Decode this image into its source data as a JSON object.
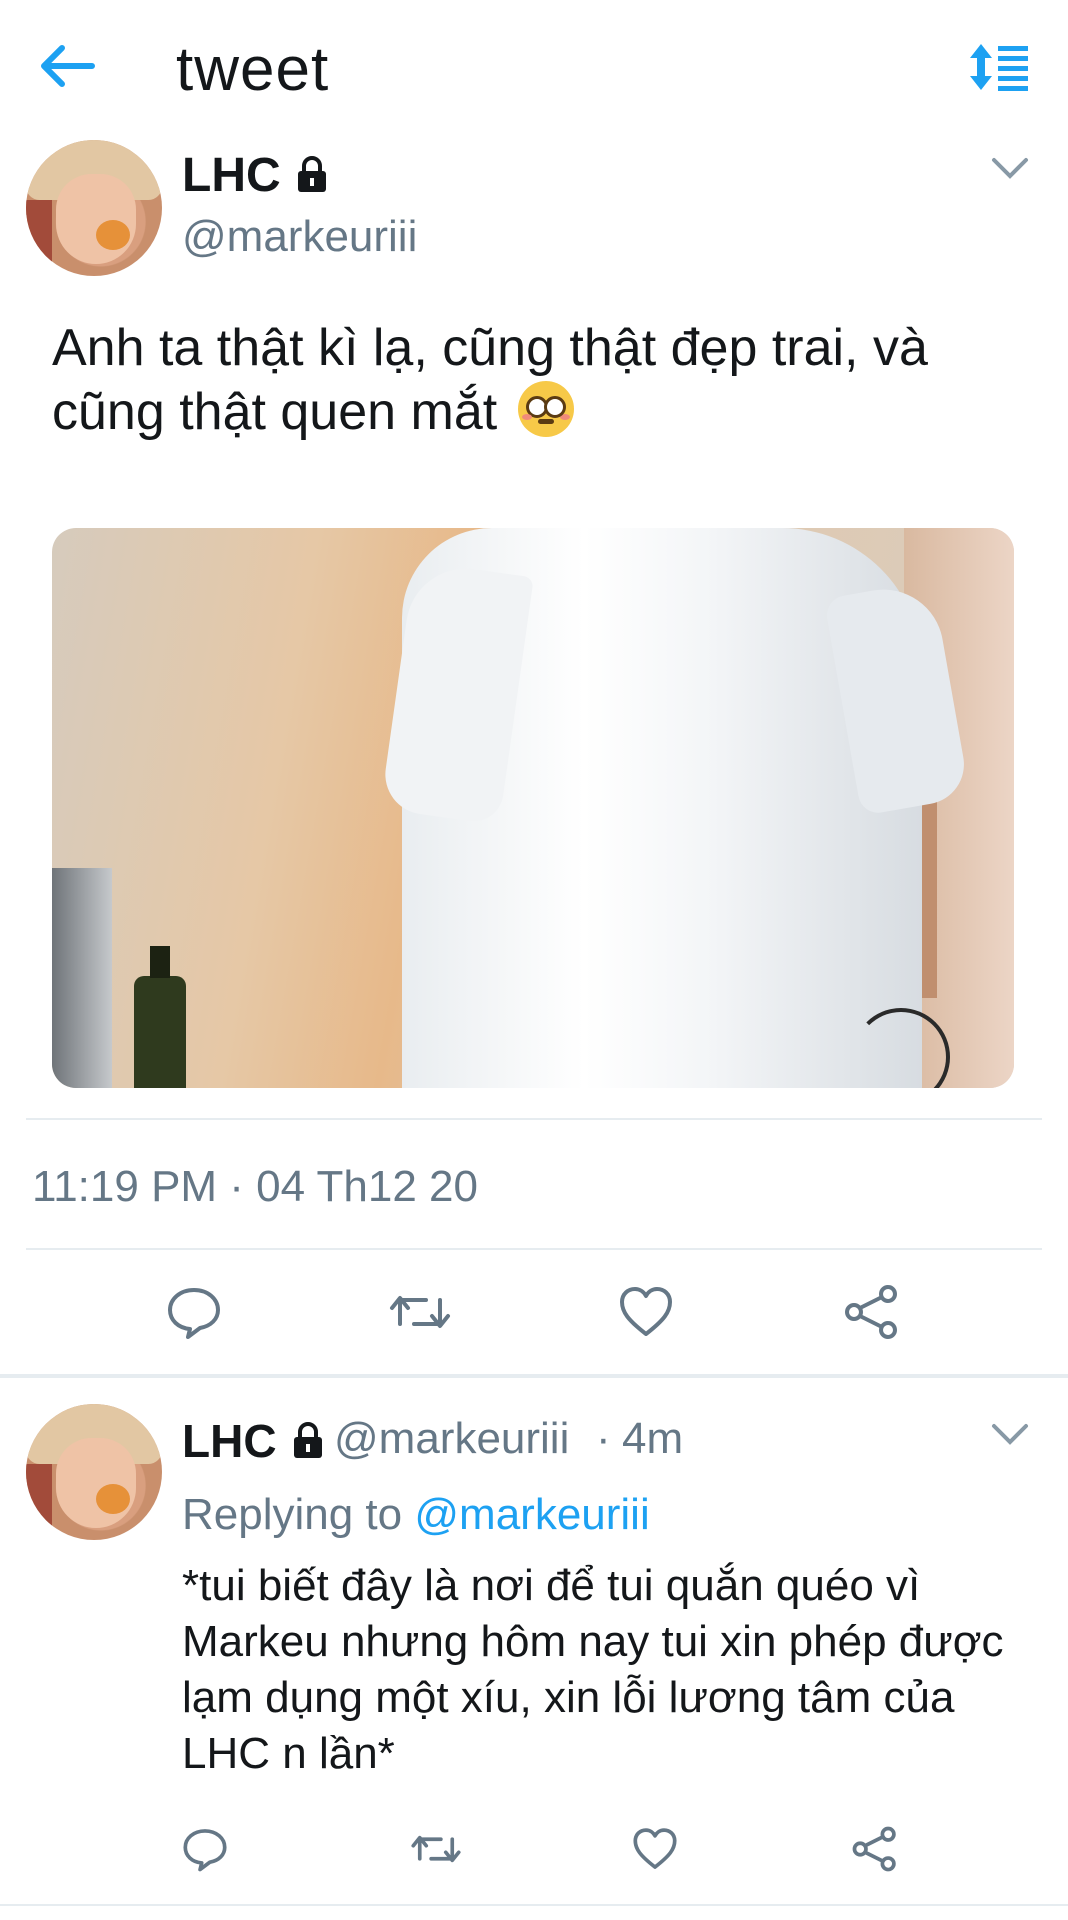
{
  "header": {
    "title": "tweet",
    "back_icon": "arrow-left-icon",
    "sort_icon": "sort-list-icon",
    "accent_color": "#1da1f2"
  },
  "tweet": {
    "author_name": "LHC",
    "author_handle": "@markeuriii",
    "protected_icon": "lock-icon",
    "text": "Anh ta thật kì lạ, cũng thật đẹp trai, và cũng thật quen mắt",
    "emoji": "flushed-face-emoji",
    "timestamp": "11:19 PM · 04 Th12 20",
    "actions": [
      "reply-icon",
      "retweet-icon",
      "like-icon",
      "share-icon"
    ]
  },
  "reply": {
    "author_name": "LHC",
    "author_handle": "@markeuriii",
    "separator": "·",
    "time_ago": "4m",
    "replying_prefix": "Replying to",
    "replying_to": "@markeuriii",
    "text": "*tui biết đây là nơi để tui quắn quéo vì Markeu nhưng hôm nay tui xin phép được lạm dụng một xíu, xin lỗi lương tâm của LHC n lần*"
  }
}
